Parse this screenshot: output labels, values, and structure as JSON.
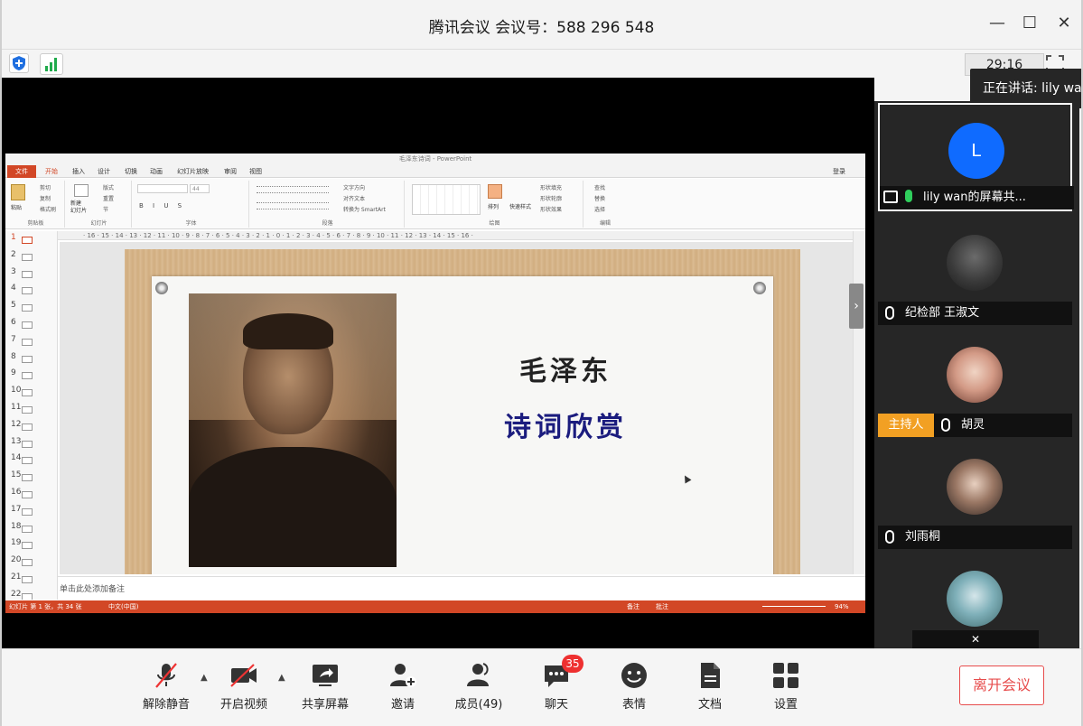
{
  "window": {
    "title": "腾讯会议 会议号：588 296 548",
    "minimize": "—",
    "maximize": "☐",
    "close": "✕"
  },
  "toolbar": {
    "timer": "29:16"
  },
  "speaking": "正在讲话: lily wan",
  "ppt": {
    "window_title": "毛泽东诗词 - PowerPoint",
    "file_tab": "文件",
    "tabs": [
      "开始",
      "插入",
      "设计",
      "切换",
      "动画",
      "幻灯片放映",
      "审阅",
      "视图"
    ],
    "login": "登录",
    "groups": [
      "剪贴板",
      "幻灯片",
      "字体",
      "段落",
      "绘图",
      "编辑"
    ],
    "ribbon": {
      "paste": "粘贴",
      "cut": "剪切",
      "copy": "复制",
      "format_painter": "格式刷",
      "new_slide": "新建\n幻灯片",
      "layout": "版式",
      "reset": "重置",
      "section": "节",
      "font_size": "44",
      "text_dir": "文字方向",
      "align_text": "对齐文本",
      "smartart": "转换为 SmartArt",
      "arrange": "排列",
      "quick_style": "快速样式",
      "shape_fill": "形状填充",
      "shape_outline": "形状轮廓",
      "shape_effect": "形状效果",
      "find": "查找",
      "replace": "替换",
      "select": "选择"
    },
    "ruler": "· 16 · 15 · 14 · 13 · 12 · 11 · 10 · 9 · 8 · 7 · 6 · 5 · 4 · 3 · 2 · 1 · 0 · 1 · 2 · 3 · 4 · 5 · 6 · 7 · 8 · 9 · 10 · 11 · 12 · 13 · 14 · 15 · 16 ·",
    "thumb_numbers": [
      "1",
      "2",
      "3",
      "4",
      "5",
      "6",
      "7",
      "8",
      "9",
      "10",
      "11",
      "12",
      "13",
      "14",
      "15",
      "16",
      "17",
      "18",
      "19",
      "20",
      "21",
      "22"
    ],
    "slide_title_1": "毛泽东",
    "slide_title_2": "诗词欣赏",
    "notes": "单击此处添加备注",
    "status_left": "幻灯片 第 1 张，共 34 张",
    "status_lang": "中文(中国)",
    "status_notes": "备注",
    "status_comments": "批注",
    "zoom": "94%"
  },
  "participants": [
    {
      "name": "lily wan的屏幕共...",
      "initial": "L",
      "active": true,
      "host": false
    },
    {
      "name": "纪检部 王淑文",
      "active": false,
      "host": false
    },
    {
      "name": "胡灵",
      "active": false,
      "host": true
    },
    {
      "name": "刘雨桐",
      "active": false,
      "host": false
    },
    {
      "name": "",
      "active": false,
      "host": false
    }
  ],
  "host_label": "主持人",
  "controls": {
    "unmute": "解除静音",
    "video": "开启视频",
    "share": "共享屏幕",
    "invite": "邀请",
    "members": "成员(49)",
    "chat": "聊天",
    "chat_badge": "35",
    "emoji": "表情",
    "docs": "文档",
    "settings": "设置",
    "leave": "离开会议"
  },
  "colors": {
    "accent_blue": "#0f6bff",
    "host_orange": "#f2a023",
    "leave_red": "#e74c4c",
    "ppt_red": "#d24726",
    "badge_red": "#ee3030"
  }
}
